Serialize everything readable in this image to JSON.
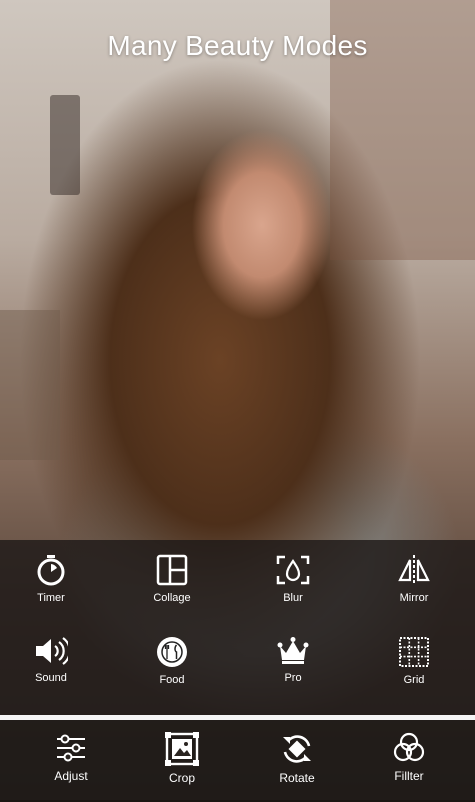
{
  "headline": "Many Beauty Modes",
  "tools": [
    {
      "label": "Timer",
      "icon": "timer-icon"
    },
    {
      "label": "Collage",
      "icon": "collage-icon"
    },
    {
      "label": "Blur",
      "icon": "blur-icon"
    },
    {
      "label": "Mirror",
      "icon": "mirror-icon"
    },
    {
      "label": "Sound",
      "icon": "sound-icon"
    },
    {
      "label": "Food",
      "icon": "food-icon"
    },
    {
      "label": "Pro",
      "icon": "crown-icon"
    },
    {
      "label": "Grid",
      "icon": "grid-icon"
    }
  ],
  "bottom_tools": [
    {
      "label": "Adjust",
      "icon": "adjust-icon"
    },
    {
      "label": "Crop",
      "icon": "crop-icon"
    },
    {
      "label": "Rotate",
      "icon": "rotate-icon"
    },
    {
      "label": "Fillter",
      "icon": "filter-icon"
    }
  ],
  "colors": {
    "panel": "#1e1a18",
    "divider": "#f5f5f5",
    "text": "#ffffff"
  }
}
